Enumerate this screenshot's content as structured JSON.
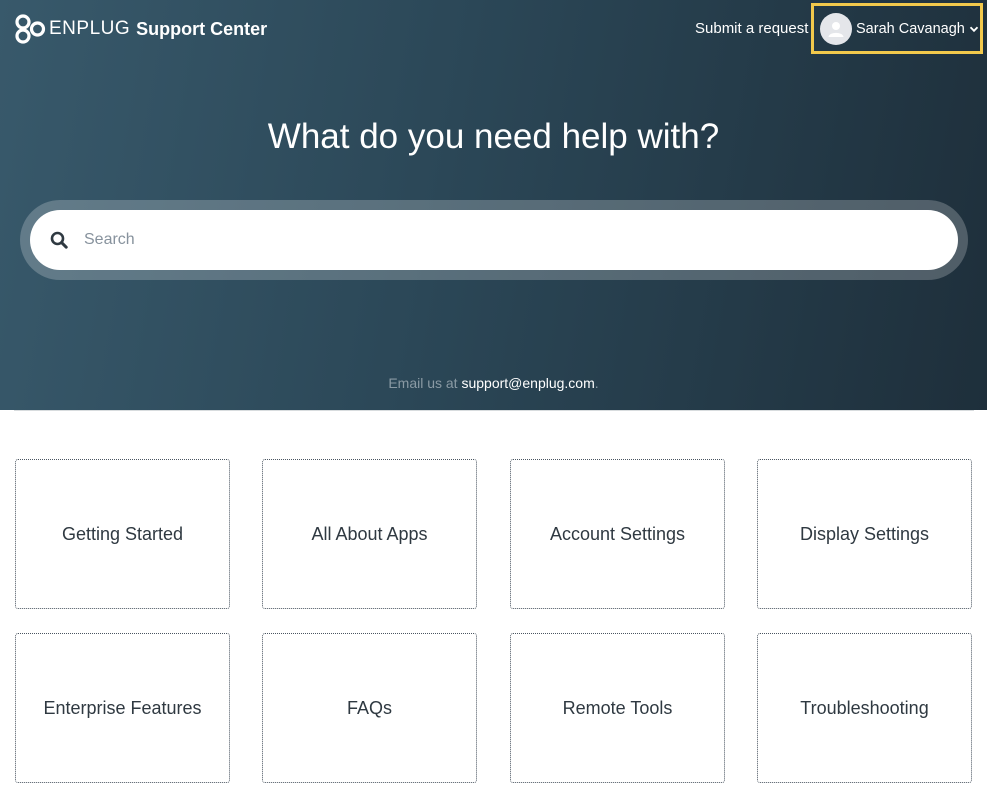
{
  "header": {
    "brand": "ENPLUG",
    "brand_suffix": "Support Center",
    "submit_request": "Submit a request",
    "user_name": "Sarah Cavanagh",
    "highlight_color": "#f2c94c"
  },
  "hero": {
    "title": "What do you need help with?",
    "search_placeholder": "Search",
    "email_prefix": "Email us at",
    "email_address": "support@enplug.com",
    "email_suffix": "."
  },
  "categories": [
    {
      "label": "Getting Started"
    },
    {
      "label": "All About Apps"
    },
    {
      "label": "Account Settings"
    },
    {
      "label": "Display Settings"
    },
    {
      "label": "Enterprise Features"
    },
    {
      "label": "FAQs"
    },
    {
      "label": "Remote Tools"
    },
    {
      "label": "Troubleshooting"
    }
  ],
  "icons": {
    "logo": "enplug-logo-icon",
    "avatar": "user-avatar-icon",
    "chevron": "chevron-down-icon",
    "search": "search-icon"
  }
}
